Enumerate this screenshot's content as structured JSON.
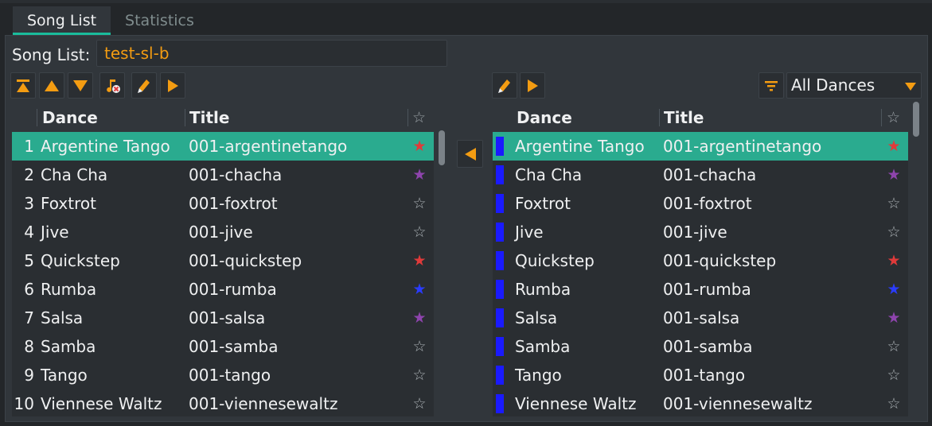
{
  "tabs": [
    {
      "label": "Song List",
      "active": true
    },
    {
      "label": "Statistics",
      "active": false
    }
  ],
  "song_list": {
    "label": "Song List:",
    "value": "test-sl-b"
  },
  "filter": {
    "selected": "All Dances"
  },
  "columns": {
    "dance": "Dance",
    "title": "Title",
    "star": "☆"
  },
  "colors": {
    "accent": "#f39c12",
    "selection": "#2aab8f",
    "bar": "#1a1aff",
    "rating_red": "#e03a3a",
    "rating_purple": "#8e44ad",
    "rating_blue": "#2a3cff",
    "rating_none": "#aab0b4"
  },
  "left_rows": [
    {
      "num": "1",
      "dance": "Argentine Tango",
      "title": "001-argentinetango",
      "star": "★",
      "rating": "red",
      "selected": true
    },
    {
      "num": "2",
      "dance": "Cha Cha",
      "title": "001-chacha",
      "star": "★",
      "rating": "purple",
      "selected": false
    },
    {
      "num": "3",
      "dance": "Foxtrot",
      "title": "001-foxtrot",
      "star": "☆",
      "rating": "none",
      "selected": false
    },
    {
      "num": "4",
      "dance": "Jive",
      "title": "001-jive",
      "star": "☆",
      "rating": "none",
      "selected": false
    },
    {
      "num": "5",
      "dance": "Quickstep",
      "title": "001-quickstep",
      "star": "★",
      "rating": "red",
      "selected": false
    },
    {
      "num": "6",
      "dance": "Rumba",
      "title": "001-rumba",
      "star": "★",
      "rating": "blue",
      "selected": false
    },
    {
      "num": "7",
      "dance": "Salsa",
      "title": "001-salsa",
      "star": "★",
      "rating": "purple",
      "selected": false
    },
    {
      "num": "8",
      "dance": "Samba",
      "title": "001-samba",
      "star": "☆",
      "rating": "none",
      "selected": false
    },
    {
      "num": "9",
      "dance": "Tango",
      "title": "001-tango",
      "star": "☆",
      "rating": "none",
      "selected": false
    },
    {
      "num": "10",
      "dance": "Viennese Waltz",
      "title": "001-viennesewaltz",
      "star": "☆",
      "rating": "none",
      "selected": false
    }
  ],
  "right_rows": [
    {
      "dance": "Argentine Tango",
      "title": "001-argentinetango",
      "star": "★",
      "rating": "red",
      "selected": true
    },
    {
      "dance": "Cha Cha",
      "title": "001-chacha",
      "star": "★",
      "rating": "purple",
      "selected": false
    },
    {
      "dance": "Foxtrot",
      "title": "001-foxtrot",
      "star": "☆",
      "rating": "none",
      "selected": false
    },
    {
      "dance": "Jive",
      "title": "001-jive",
      "star": "☆",
      "rating": "none",
      "selected": false
    },
    {
      "dance": "Quickstep",
      "title": "001-quickstep",
      "star": "★",
      "rating": "red",
      "selected": false
    },
    {
      "dance": "Rumba",
      "title": "001-rumba",
      "star": "★",
      "rating": "blue",
      "selected": false
    },
    {
      "dance": "Salsa",
      "title": "001-salsa",
      "star": "★",
      "rating": "purple",
      "selected": false
    },
    {
      "dance": "Samba",
      "title": "001-samba",
      "star": "☆",
      "rating": "none",
      "selected": false
    },
    {
      "dance": "Tango",
      "title": "001-tango",
      "star": "☆",
      "rating": "none",
      "selected": false
    },
    {
      "dance": "Viennese Waltz",
      "title": "001-viennesewaltz",
      "star": "☆",
      "rating": "none",
      "selected": false
    }
  ],
  "icons": {
    "left_toolbar": [
      "move-to-top-icon",
      "move-up-icon",
      "move-down-icon",
      "remove-song-icon",
      "edit-icon",
      "play-icon"
    ],
    "right_toolbar": [
      "edit-icon",
      "play-icon"
    ],
    "middle": "add-to-list-icon",
    "filter": "filter-icon"
  }
}
